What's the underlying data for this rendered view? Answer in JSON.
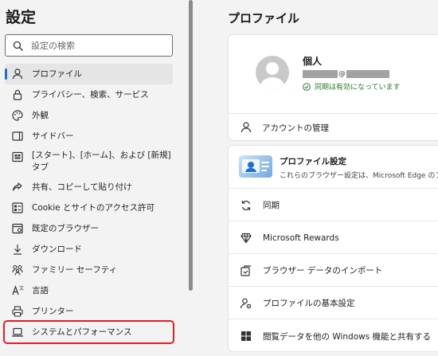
{
  "sidebar": {
    "title": "設定",
    "search_placeholder": "設定の検索",
    "items": [
      {
        "label": "プロファイル",
        "icon": "profile-icon"
      },
      {
        "label": "プライバシー、検索、サービス",
        "icon": "lock-icon"
      },
      {
        "label": "外観",
        "icon": "palette-icon"
      },
      {
        "label": "サイドバー",
        "icon": "sidebar-icon"
      },
      {
        "label": "[スタート]、[ホーム]、および [新規] タブ",
        "icon": "start-page-icon"
      },
      {
        "label": "共有、コピーして貼り付け",
        "icon": "share-icon"
      },
      {
        "label": "Cookie とサイトのアクセス許可",
        "icon": "site-permissions-icon"
      },
      {
        "label": "既定のブラウザー",
        "icon": "default-browser-icon"
      },
      {
        "label": "ダウンロード",
        "icon": "download-icon"
      },
      {
        "label": "ファミリー セーフティ",
        "icon": "family-icon"
      },
      {
        "label": "言語",
        "icon": "language-icon"
      },
      {
        "label": "プリンター",
        "icon": "printer-icon"
      },
      {
        "label": "システムとパフォーマンス",
        "icon": "laptop-icon"
      }
    ]
  },
  "main": {
    "title": "プロファイル",
    "profile": {
      "name": "個人",
      "email_at": "@",
      "sync_status": "同期は有効になっています"
    },
    "account_manage": "アカウントの管理",
    "profile_settings": {
      "title": "プロファイル設定",
      "desc": "これらのブラウザー設定は、Microsoft Edge のプロ"
    },
    "rows": [
      {
        "label": "同期",
        "icon": "sync-icon"
      },
      {
        "label": "Microsoft Rewards",
        "icon": "rewards-icon"
      },
      {
        "label": "ブラウザー データのインポート",
        "icon": "import-icon"
      },
      {
        "label": "プロファイルの基本設定",
        "icon": "profile-preferences-icon"
      },
      {
        "label": "閲覧データを他の Windows 機能と共有する",
        "icon": "windows-icon"
      }
    ]
  },
  "colors": {
    "accent": "#1f6fd1",
    "highlight": "#e01e25",
    "sync_green": "#2c7a2c"
  }
}
